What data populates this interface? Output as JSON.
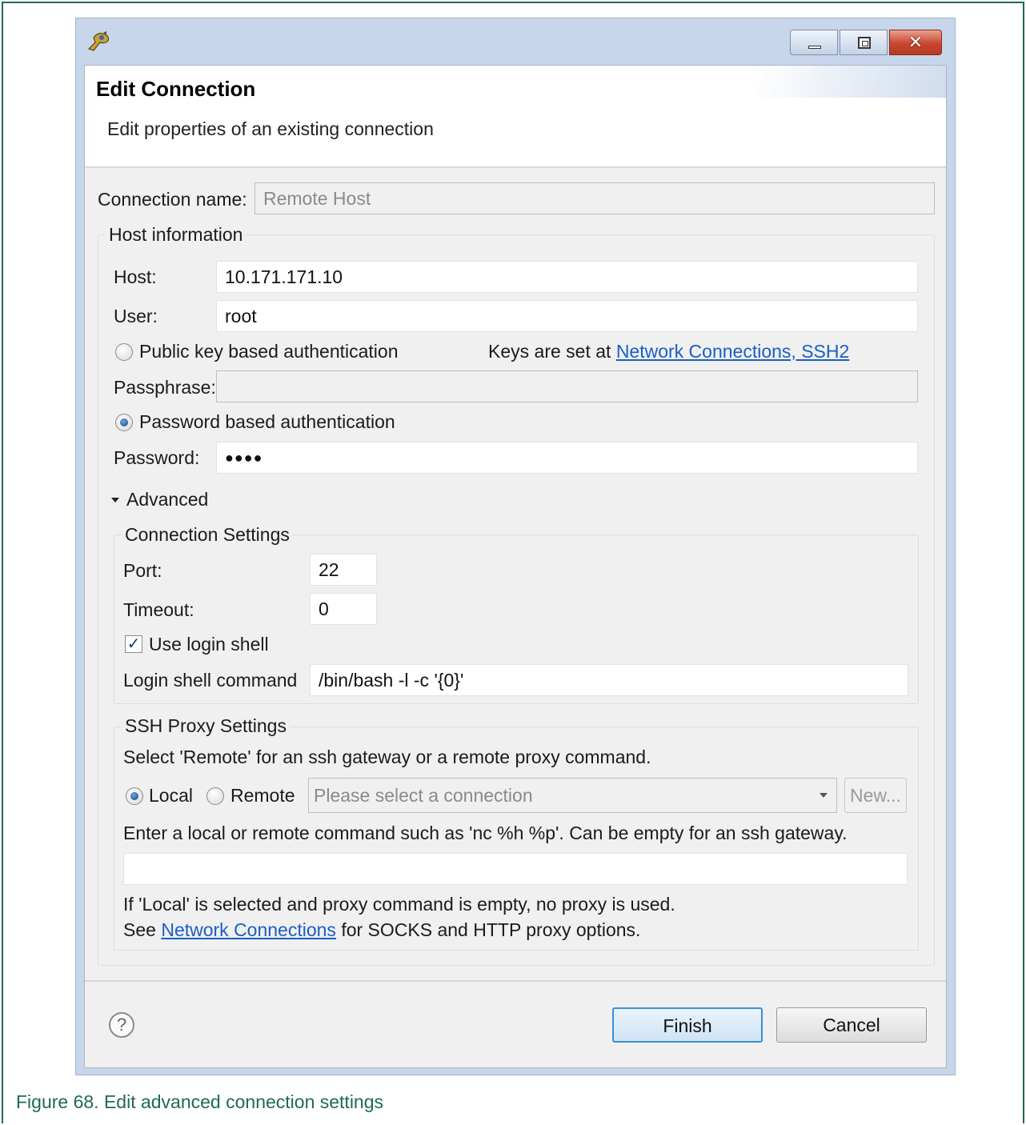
{
  "window": {
    "minimize_icon": "minimize-icon",
    "maximize_icon": "maximize-icon",
    "close_glyph": "✕"
  },
  "header": {
    "title": "Edit Connection",
    "description": "Edit properties of an existing connection"
  },
  "connection": {
    "name_label": "Connection name:",
    "name_value": "Remote Host"
  },
  "host_info": {
    "group_label": "Host information",
    "host_label": "Host:",
    "host_value": "10.171.171.10",
    "user_label": "User:",
    "user_value": "root",
    "public_key_label": "Public key based authentication",
    "keys_text": "Keys are set at ",
    "keys_link": "Network Connections, SSH2",
    "passphrase_label": "Passphrase:",
    "passphrase_value": "",
    "password_auth_label": "Password based authentication",
    "password_label": "Password:",
    "password_value": "●●●●",
    "auth_method": "password"
  },
  "advanced": {
    "toggle_label": "Advanced",
    "expanded": true,
    "connection_settings": {
      "group_label": "Connection Settings",
      "port_label": "Port:",
      "port_value": "22",
      "timeout_label": "Timeout:",
      "timeout_value": "0",
      "use_login_shell_label": "Use login shell",
      "use_login_shell_checked": true,
      "login_shell_command_label": "Login shell command",
      "login_shell_command_value": "/bin/bash -l -c '{0}'"
    },
    "ssh_proxy": {
      "group_label": "SSH Proxy Settings",
      "instruction": "Select 'Remote' for an ssh gateway or a remote proxy command.",
      "local_label": "Local",
      "remote_label": "Remote",
      "selected": "local",
      "connection_select_placeholder": "Please select a connection",
      "new_button": "New...",
      "command_hint": "Enter a local or remote command such as 'nc %h %p'. Can be empty for an ssh gateway.",
      "command_value": "",
      "note_line1": "If 'Local' is selected and proxy command is empty, no proxy is used.",
      "note_line2_prefix": "See ",
      "note_line2_link": "Network Connections",
      "note_line2_suffix": " for SOCKS and HTTP proxy options."
    }
  },
  "footer": {
    "help_glyph": "?",
    "finish_label": "Finish",
    "cancel_label": "Cancel"
  },
  "figure_caption": "Figure 68.  Edit advanced connection settings"
}
